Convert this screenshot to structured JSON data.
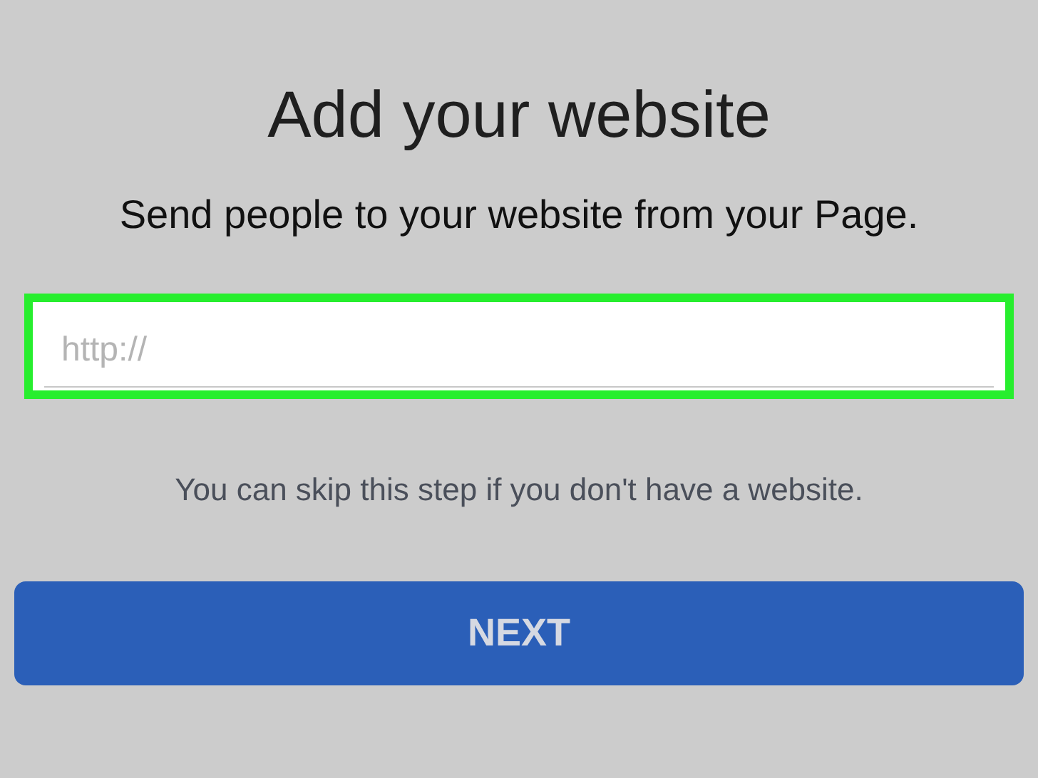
{
  "title": "Add your website",
  "subtitle": "Send people to your website from your Page.",
  "website_field": {
    "placeholder": "http://",
    "highlighted": true
  },
  "hint": "You can skip this step if you don't have a website.",
  "next_button": {
    "label": "NEXT"
  }
}
